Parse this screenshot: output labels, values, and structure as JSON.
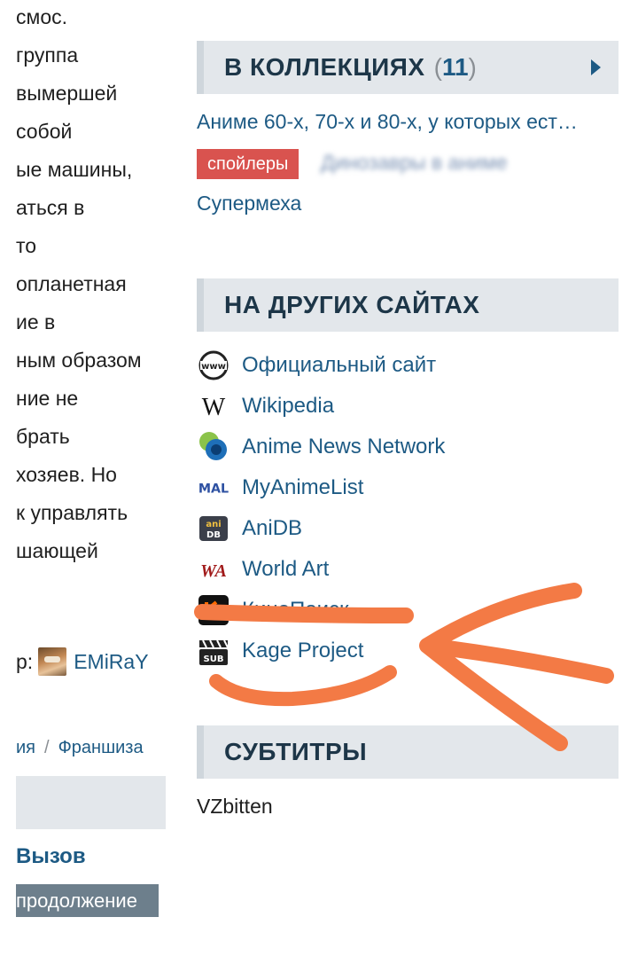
{
  "description_fragments": [
    "смос.",
    "группа",
    "вымершей",
    "собой",
    "ые машины,",
    "аться в",
    "то",
    "опланетная",
    "ие в",
    "ным образом",
    "ние не",
    "брать",
    "хозяев. Но",
    "к управлять",
    "шающей"
  ],
  "author": {
    "prefix": "р:",
    "name": "EMiRaY"
  },
  "breadcrumbs": {
    "item1": "ия",
    "separator": "/",
    "item2": "Франшиза"
  },
  "related": {
    "title": "Вызов",
    "tag": "продолжение"
  },
  "collections": {
    "title": "В КОЛЛЕКЦИЯХ",
    "open_paren": "(",
    "count": "11",
    "close_paren": ")",
    "items": [
      "Аниме 60-х, 70-х и 80-х, у которых ест…",
      "Динозавры в аниме",
      "Супермеха"
    ],
    "spoiler_label": "спойлеры"
  },
  "other_sites": {
    "title": "НА ДРУГИХ САЙТАХ",
    "items": [
      {
        "label": "Официальный сайт",
        "icon": "globe-www-icon"
      },
      {
        "label": "Wikipedia",
        "icon": "wikipedia-icon"
      },
      {
        "label": "Anime News Network",
        "icon": "ann-icon"
      },
      {
        "label": "MyAnimeList",
        "icon": "mal-icon"
      },
      {
        "label": "AniDB",
        "icon": "anidb-icon"
      },
      {
        "label": "World Art",
        "icon": "worldart-icon"
      },
      {
        "label": "КиноПоиск",
        "icon": "kinopoisk-icon"
      },
      {
        "label": "Kage Project",
        "icon": "kage-sub-icon"
      }
    ]
  },
  "subtitles": {
    "title": "СУБТИТРЫ",
    "group": "VZbitten"
  },
  "colors": {
    "link": "#1d5a84",
    "header_bg": "#e3e7eb",
    "spoiler": "#d9534f",
    "annotation": "#f37a45"
  }
}
